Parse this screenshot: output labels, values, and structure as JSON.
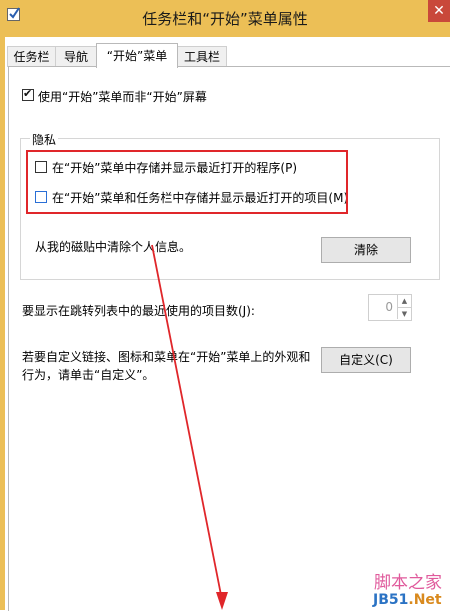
{
  "window": {
    "title": "任务栏和“开始”菜单属性",
    "close_label": "✕"
  },
  "tabs": [
    {
      "label": "任务栏"
    },
    {
      "label": "导航"
    },
    {
      "label": "“开始”菜单"
    },
    {
      "label": "工具栏"
    }
  ],
  "options": {
    "use_start_menu_label": "使用“开始”菜单而非“开始”屏幕",
    "use_start_menu_checked": true
  },
  "privacy": {
    "group_title": "隐私",
    "store_programs_label": "在“开始”菜单中存储并显示最近打开的程序(P)",
    "store_items_label": "在“开始”菜单和任务栏中存储并显示最近打开的项目(M)",
    "clear_info_label": "从我的磁贴中清除个人信息。",
    "clear_button_label": "清除"
  },
  "jumplist": {
    "label": "要显示在跳转列表中的最近使用的项目数(J):",
    "value": "0"
  },
  "customize": {
    "description_line1": "若要自定义链接、图标和菜单在“开始”菜单上的外观和",
    "description_line2": "行为，请单击“自定义”。",
    "button_label": "自定义(C)"
  },
  "watermark": {
    "line1": "脚本之家",
    "line2_a": "JB51",
    "line2_b": ".Net"
  },
  "colors": {
    "titlebar": "#ecbf56",
    "highlight": "#e0262a",
    "arrow": "#e0262a"
  }
}
